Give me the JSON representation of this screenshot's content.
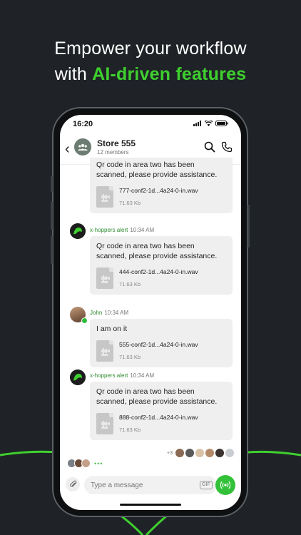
{
  "headline": {
    "line1": "Empower your workflow",
    "line2_prefix": "with ",
    "line2_accent": "AI-driven features"
  },
  "colors": {
    "accent": "#3fcf2f",
    "background": "#1f2327",
    "bubble": "#efefef",
    "sender": "#2e8b2e",
    "ptt": "#34c13a"
  },
  "status_bar": {
    "time": "16:20",
    "icons": [
      "signal-icon",
      "wifi-icon",
      "battery-icon"
    ]
  },
  "header": {
    "title": "Store 555",
    "subtitle": "12 members",
    "icons": [
      "back-chevron-icon",
      "group-icon",
      "search-icon",
      "phone-icon"
    ]
  },
  "messages": [
    {
      "sender": "",
      "time": "",
      "text": "Qr code in area two has been scanned, please provide assistance.",
      "file": {
        "name": "777-conf2-1d...4a24-0-in.wav",
        "size": "71.63 Kb",
        "type_label": "wav"
      }
    },
    {
      "sender": "x-hoppers alert",
      "time": "10:34 AM",
      "text": "Qr code in area two has been scanned, please provide assistance.",
      "file": {
        "name": "444-conf2-1d...4a24-0-in.wav",
        "size": "71.63 Kb",
        "type_label": "wav"
      }
    },
    {
      "sender": "John",
      "time": "10:34 AM",
      "text": "I am on it",
      "file": {
        "name": "555-conf2-1d...4a24-0-in.wav",
        "size": "71.63 Kb",
        "type_label": "wav"
      }
    },
    {
      "sender": "x-hoppers alert",
      "time": "10:34 AM",
      "text": "Qr code in area two has been scanned, please provide assistance.",
      "file": {
        "name": "888-conf2-1d...4a24-0-in.wav",
        "size": "71.63 Kb",
        "type_label": "wav"
      }
    }
  ],
  "read_receipts": {
    "extra_count": "+3"
  },
  "typing": {
    "indicator": "•••"
  },
  "composer": {
    "placeholder": "Type a message",
    "gif_label": "GIF"
  }
}
